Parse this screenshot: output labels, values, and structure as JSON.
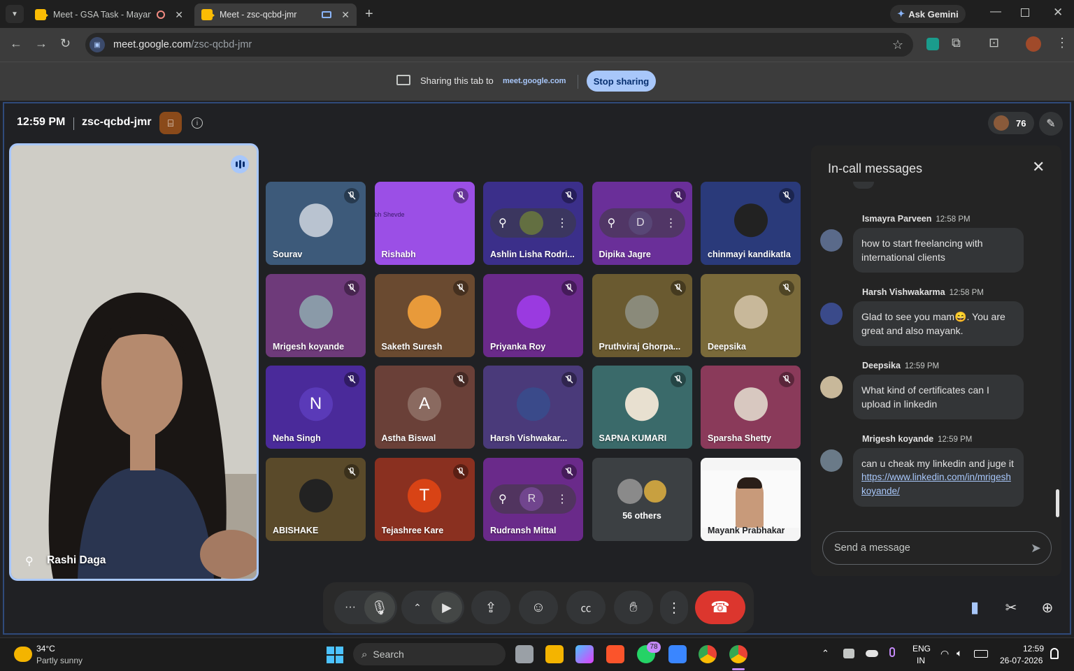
{
  "browser": {
    "tabs": [
      {
        "label": "Meet - GSA Task - Mayank P",
        "active": false
      },
      {
        "label": "Meet - zsc-qcbd-jmr",
        "active": true
      }
    ],
    "ask_gemini": "Ask Gemini",
    "url_domain": "meet.google.com",
    "url_path": "/zsc-qcbd-jmr"
  },
  "share_bar": {
    "text": "Sharing this tab to",
    "target": "meet.google.com",
    "stop_label": "Stop sharing"
  },
  "meeting": {
    "time": "12:59 PM",
    "code": "zsc-qcbd-jmr",
    "participant_count": "76",
    "speaker_name": "Rashi Daga"
  },
  "tiles": [
    {
      "name": "Sourav",
      "bg": "#3d5a7a",
      "type": "avatar",
      "avatar_color": "#b9c3d0",
      "muted": true
    },
    {
      "name": "Rishabh",
      "bg": "#9b4fe6",
      "type": "screen",
      "screen_text": "bh  Shevde",
      "muted": true
    },
    {
      "name": "Ashlin Lisha Rodri...",
      "bg": "#3b2f8a",
      "type": "overlay",
      "overlay_letter": "",
      "avatar_color": "#6e7e3a",
      "muted": true
    },
    {
      "name": "Dipika Jagre",
      "bg": "#6a2f99",
      "type": "overlay",
      "overlay_letter": "D",
      "avatar_color": "#5a4a7a",
      "muted": true
    },
    {
      "name": "chinmayi kandikatla",
      "bg": "#2a3a7a",
      "type": "avatar",
      "avatar_color": "#222222",
      "muted": true
    },
    {
      "name": "Mrigesh koyande",
      "bg": "#6e3a7a",
      "type": "avatar",
      "avatar_color": "#8a9aa8",
      "muted": true
    },
    {
      "name": "Saketh Suresh",
      "bg": "#6a4a30",
      "type": "avatar",
      "avatar_color": "#e89a3a",
      "muted": true
    },
    {
      "name": "Priyanka Roy",
      "bg": "#6a2a8a",
      "type": "avatar",
      "avatar_color": "#9a3ae0",
      "muted": true
    },
    {
      "name": "Pruthviraj Ghorpa...",
      "bg": "#6a5a30",
      "type": "avatar",
      "avatar_color": "#8a8a7a",
      "muted": true
    },
    {
      "name": "Deepsika",
      "bg": "#7a6a3a",
      "type": "avatar",
      "avatar_color": "#c8b89a",
      "muted": true
    },
    {
      "name": "Neha Singh",
      "bg": "#4a2a9a",
      "type": "letter",
      "letter": "N",
      "avatar_color": "#5a3ab8",
      "muted": true
    },
    {
      "name": "Astha Biswal",
      "bg": "#6a4038",
      "type": "letter",
      "letter": "A",
      "avatar_color": "#8a6a60",
      "muted": true
    },
    {
      "name": "Harsh Vishwakar...",
      "bg": "#4a3a7a",
      "type": "avatar",
      "avatar_color": "#3a4a8a",
      "muted": true
    },
    {
      "name": "SAPNA KUMARI",
      "bg": "#3a6a6a",
      "type": "avatar",
      "avatar_color": "#e8e0d0",
      "muted": true
    },
    {
      "name": "Sparsha Shetty",
      "bg": "#8a3a5a",
      "type": "avatar",
      "avatar_color": "#d8c8c0",
      "muted": true
    },
    {
      "name": "ABISHAKE",
      "bg": "#5a4a2a",
      "type": "avatar",
      "avatar_color": "#222222",
      "muted": true
    },
    {
      "name": "Tejashree Kare",
      "bg": "#8a3020",
      "type": "letter",
      "letter": "T",
      "avatar_color": "#d84315",
      "muted": true
    },
    {
      "name": "Rudransh Mittal",
      "bg": "#6a2a8a",
      "type": "overlay",
      "overlay_letter": "R",
      "avatar_color": "#7a4a9a",
      "muted": true
    },
    {
      "name": "",
      "bg": "#3c4043",
      "type": "others",
      "others_label": "56 others",
      "muted": false
    },
    {
      "name": "Mayank Prabhakar",
      "bg": "#f5f5f5",
      "type": "camera",
      "muted": false
    }
  ],
  "chat": {
    "title": "In-call messages",
    "input_placeholder": "Send a message",
    "messages": [
      {
        "sender": "Ismayra Parveen",
        "time": "12:58 PM",
        "text": "how to start freelancing with international clients",
        "avatar_color": "#5a6a8a"
      },
      {
        "sender": "Harsh Vishwakarma",
        "time": "12:58 PM",
        "text": "Glad to see you mam😄. You are great and also mayank.",
        "avatar_color": "#3a4a8a"
      },
      {
        "sender": "Deepsika",
        "time": "12:59 PM",
        "text": "What kind of certificates can I upload in linkedin",
        "avatar_color": "#c8b89a"
      },
      {
        "sender": "Mrigesh koyande",
        "time": "12:59 PM",
        "text": "can u cheak my linkedin and juge it",
        "link": "https://www.linkedin.com/in/mrigeshkoyande/",
        "avatar_color": "#6a7a88"
      }
    ]
  },
  "taskbar": {
    "weather_temp": "34°C",
    "weather_desc": "Partly sunny",
    "search_placeholder": "Search",
    "whatsapp_badge": "78",
    "lang_top": "ENG",
    "lang_bottom": "IN",
    "clock_time": "12:59",
    "clock_date": "26-07-2026"
  },
  "colors": {
    "accent": "#a8c7fa",
    "end_call": "#dc362e",
    "tile_bg": "#3c4043"
  }
}
